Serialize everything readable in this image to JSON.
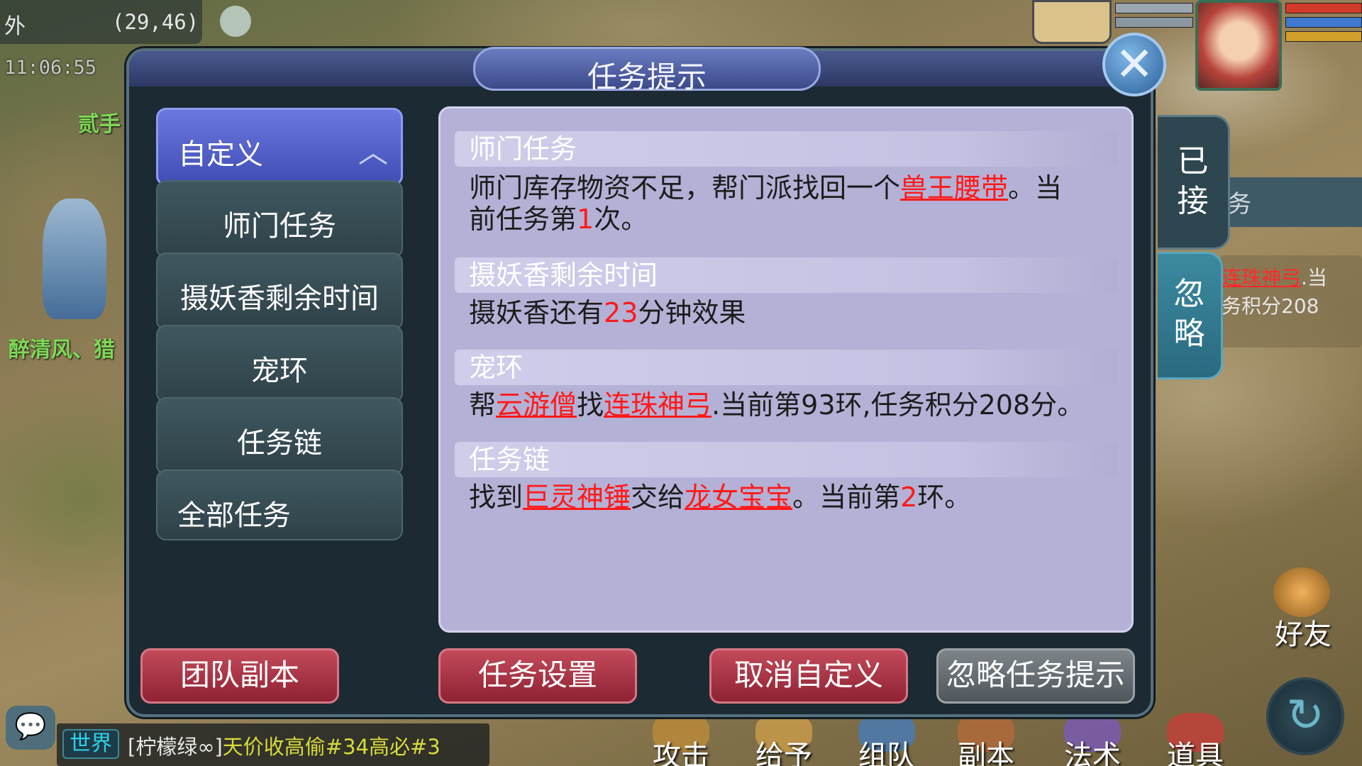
{
  "hud": {
    "location_label": "外",
    "coords": "(29,46)",
    "time": "11:06:55",
    "npc_name_1": "贰手",
    "npc_name_2": "醉清风、猎"
  },
  "side": {
    "partial_tab": "务",
    "partial_link": "连珠神弓",
    "partial_tail": ".当",
    "partial_line2": "务积分208"
  },
  "dialog": {
    "title": "任务提示",
    "close_icon": "close-icon"
  },
  "menu": {
    "items": [
      {
        "label": "自定义",
        "active": true
      },
      {
        "label": "师门任务"
      },
      {
        "label": "摄妖香剩余时间"
      },
      {
        "label": "宠环"
      },
      {
        "label": "任务链"
      },
      {
        "label": "全部任务"
      }
    ]
  },
  "tabs": {
    "accepted": [
      "已",
      "接"
    ],
    "ignored": [
      "忽",
      "略"
    ]
  },
  "sections": {
    "s1": {
      "header": "师门任务",
      "t1": "师门库存物资不足，帮门派找回一个",
      "link1": "兽王腰带",
      "t2": "。当",
      "t3": "前任务第",
      "num": "1",
      "t4": "次。"
    },
    "s2": {
      "header": "摄妖香剩余时间",
      "t1": "摄妖香还有",
      "num": "23",
      "t2": "分钟效果"
    },
    "s3": {
      "header": "宠环",
      "t1": "帮",
      "link1": "云游僧",
      "t2": "找",
      "link2": "连珠神弓",
      "t3": ".当前第93环,任务积分208分。"
    },
    "s4": {
      "header": "任务链",
      "t1": "找到",
      "link1": "巨灵神锤",
      "t2": "交给",
      "link2": "龙女宝宝",
      "t3": "。当前第",
      "num": "2",
      "t4": "环。"
    }
  },
  "actions": {
    "team_dungeon": "团队副本",
    "task_settings": "任务设置",
    "cancel_custom": "取消自定义",
    "ignore_prompt": "忽略任务提示"
  },
  "bottom": {
    "chat_channel": "世界",
    "chat_sender": "[柠檬绿∞]",
    "chat_text": "天价收高偷#34高必#3",
    "skills": [
      "攻击",
      "给予",
      "组队",
      "副本",
      "法术",
      "道具"
    ],
    "friend": "好友"
  },
  "colors": {
    "link_red": "#ff1a1a",
    "panel_bg": "#b4b1d6",
    "menu_active": "#5564d0",
    "btn_red": "#a8344a"
  }
}
